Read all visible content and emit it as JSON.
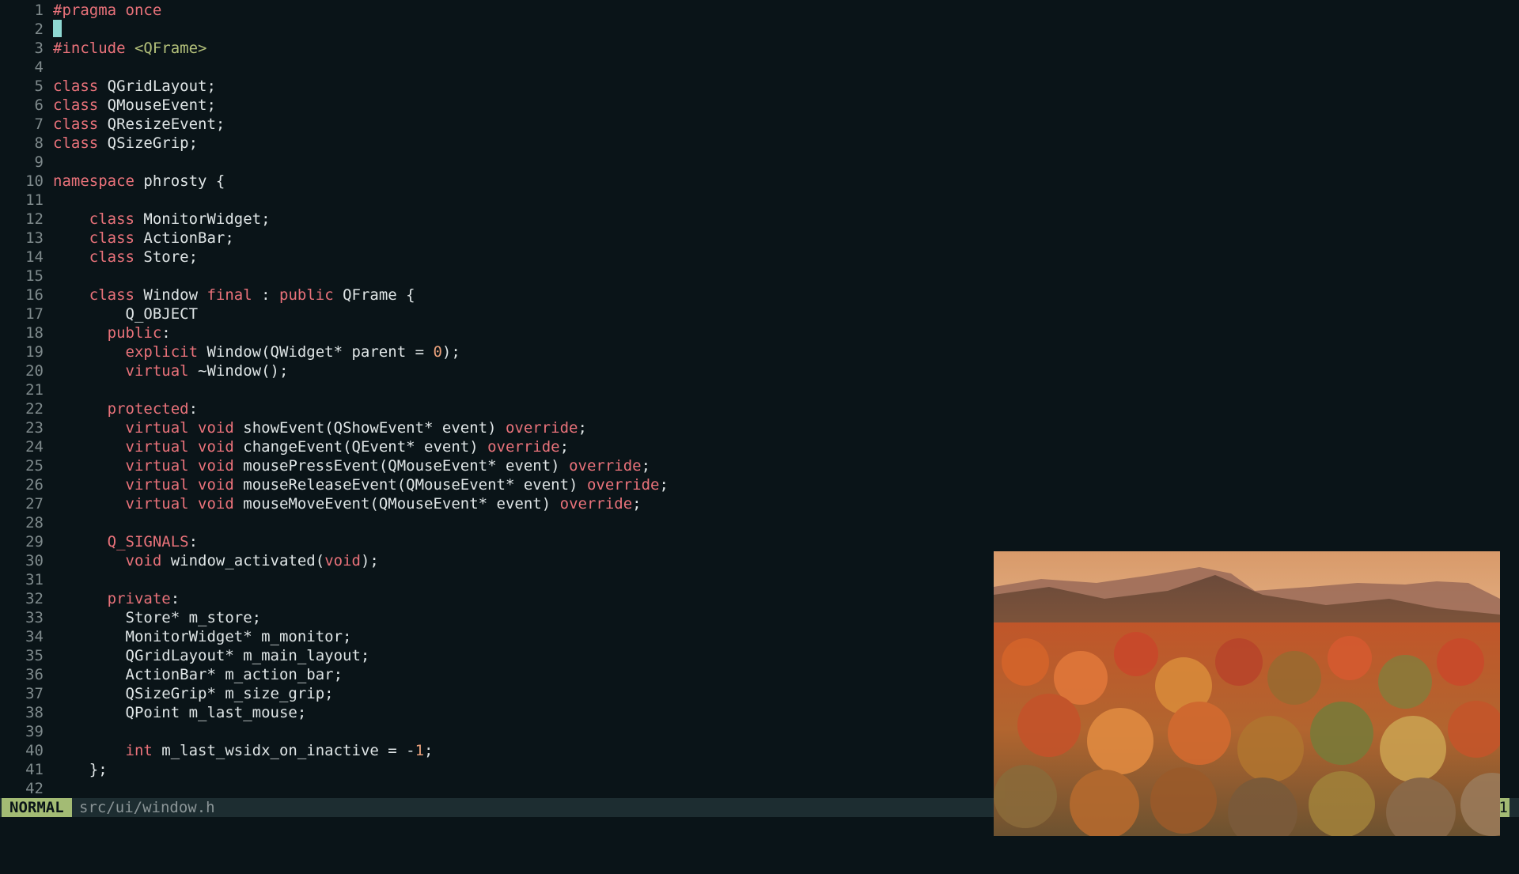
{
  "editor": {
    "lines": [
      [
        [
          "p",
          "#pragma once"
        ]
      ],
      [
        [
          "cursor",
          ""
        ]
      ],
      [
        [
          "p",
          "#include "
        ],
        [
          "s",
          "<QFrame>"
        ]
      ],
      [],
      [
        [
          "k",
          "class"
        ],
        [
          "",
          " QGridLayout;"
        ]
      ],
      [
        [
          "k",
          "class"
        ],
        [
          "",
          " QMouseEvent;"
        ]
      ],
      [
        [
          "k",
          "class"
        ],
        [
          "",
          " QResizeEvent;"
        ]
      ],
      [
        [
          "k",
          "class"
        ],
        [
          "",
          " QSizeGrip;"
        ]
      ],
      [],
      [
        [
          "k",
          "namespace"
        ],
        [
          "",
          " phrosty {"
        ]
      ],
      [],
      [
        [
          "",
          "    "
        ],
        [
          "k",
          "class"
        ],
        [
          "",
          " MonitorWidget;"
        ]
      ],
      [
        [
          "",
          "    "
        ],
        [
          "k",
          "class"
        ],
        [
          "",
          " ActionBar;"
        ]
      ],
      [
        [
          "",
          "    "
        ],
        [
          "k",
          "class"
        ],
        [
          "",
          " Store;"
        ]
      ],
      [],
      [
        [
          "",
          "    "
        ],
        [
          "k",
          "class"
        ],
        [
          "",
          " Window "
        ],
        [
          "k",
          "final"
        ],
        [
          "",
          " : "
        ],
        [
          "k",
          "public"
        ],
        [
          "",
          " QFrame {"
        ]
      ],
      [
        [
          "",
          "        Q_OBJECT"
        ]
      ],
      [
        [
          "",
          "      "
        ],
        [
          "k",
          "public"
        ],
        [
          "",
          ":"
        ]
      ],
      [
        [
          "",
          "        "
        ],
        [
          "k",
          "explicit"
        ],
        [
          "",
          " Window(QWidget* parent = "
        ],
        [
          "n",
          "0"
        ],
        [
          "",
          ");"
        ]
      ],
      [
        [
          "",
          "        "
        ],
        [
          "k",
          "virtual"
        ],
        [
          "",
          " ~Window();"
        ]
      ],
      [],
      [
        [
          "",
          "      "
        ],
        [
          "k",
          "protected"
        ],
        [
          "",
          ":"
        ]
      ],
      [
        [
          "",
          "        "
        ],
        [
          "k",
          "virtual"
        ],
        [
          "",
          " "
        ],
        [
          "t",
          "void"
        ],
        [
          "",
          " showEvent(QShowEvent* event) "
        ],
        [
          "k",
          "override"
        ],
        [
          "",
          ";"
        ]
      ],
      [
        [
          "",
          "        "
        ],
        [
          "k",
          "virtual"
        ],
        [
          "",
          " "
        ],
        [
          "t",
          "void"
        ],
        [
          "",
          " changeEvent(QEvent* event) "
        ],
        [
          "k",
          "override"
        ],
        [
          "",
          ";"
        ]
      ],
      [
        [
          "",
          "        "
        ],
        [
          "k",
          "virtual"
        ],
        [
          "",
          " "
        ],
        [
          "t",
          "void"
        ],
        [
          "",
          " mousePressEvent(QMouseEvent* event) "
        ],
        [
          "k",
          "override"
        ],
        [
          "",
          ";"
        ]
      ],
      [
        [
          "",
          "        "
        ],
        [
          "k",
          "virtual"
        ],
        [
          "",
          " "
        ],
        [
          "t",
          "void"
        ],
        [
          "",
          " mouseReleaseEvent(QMouseEvent* event) "
        ],
        [
          "k",
          "override"
        ],
        [
          "",
          ";"
        ]
      ],
      [
        [
          "",
          "        "
        ],
        [
          "k",
          "virtual"
        ],
        [
          "",
          " "
        ],
        [
          "t",
          "void"
        ],
        [
          "",
          " mouseMoveEvent(QMouseEvent* event) "
        ],
        [
          "k",
          "override"
        ],
        [
          "",
          ";"
        ]
      ],
      [],
      [
        [
          "",
          "      "
        ],
        [
          "k",
          "Q_SIGNALS"
        ],
        [
          "",
          ":"
        ]
      ],
      [
        [
          "",
          "        "
        ],
        [
          "t",
          "void"
        ],
        [
          "",
          " window_activated("
        ],
        [
          "t",
          "void"
        ],
        [
          "",
          ");"
        ]
      ],
      [],
      [
        [
          "",
          "      "
        ],
        [
          "k",
          "private"
        ],
        [
          "",
          ":"
        ]
      ],
      [
        [
          "",
          "        Store* m_store;"
        ]
      ],
      [
        [
          "",
          "        MonitorWidget* m_monitor;"
        ]
      ],
      [
        [
          "",
          "        QGridLayout* m_main_layout;"
        ]
      ],
      [
        [
          "",
          "        ActionBar* m_action_bar;"
        ]
      ],
      [
        [
          "",
          "        QSizeGrip* m_size_grip;"
        ]
      ],
      [
        [
          "",
          "        QPoint m_last_mouse;"
        ]
      ],
      [],
      [
        [
          "",
          "        "
        ],
        [
          "t",
          "int"
        ],
        [
          "",
          " m_last_wsidx_on_inactive = -"
        ],
        [
          "n",
          "1"
        ],
        [
          "",
          ";"
        ]
      ],
      [
        [
          "",
          "    };"
        ]
      ],
      []
    ]
  },
  "statusbar": {
    "mode": "NORMAL",
    "filename": "src/ui/window.h",
    "tail": "1"
  },
  "colors": {
    "background": "#0a1418",
    "keyword": "#e9727a",
    "string": "#b3c07a",
    "number": "#e9a07b",
    "mode_bg": "#a3bb74",
    "cursor": "#8fd8d2"
  },
  "pip_video": {
    "icon": "autumn-forest-mountains-video"
  }
}
